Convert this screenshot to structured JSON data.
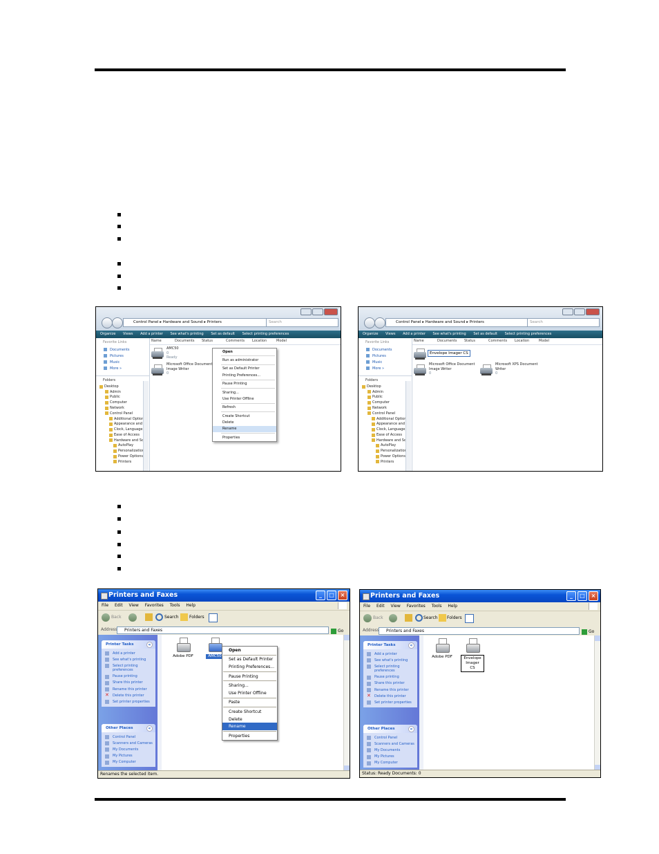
{
  "vista_left": {
    "address": [
      "Control Panel",
      "Hardware and Sound",
      "Printers"
    ],
    "search_placeholder": "Search",
    "toolbar": [
      "Organize",
      "Views",
      "Add a printer",
      "See what's printing",
      "Set as default",
      "Select printing preferences"
    ],
    "favorite_links_title": "Favorite Links",
    "favorite_links": [
      "Documents",
      "Pictures",
      "Music",
      "More »"
    ],
    "folders_label": "Folders",
    "tree": [
      "Desktop",
      "Admin",
      "Public",
      "Computer",
      "Network",
      "Control Panel",
      "Additional Options",
      "Appearance and P",
      "Clock, Language, a",
      "Ease of Access",
      "Hardware and Sou",
      "AutoPlay",
      "Personalization",
      "Power Options",
      "Printers"
    ],
    "columns": [
      "Name",
      "Documents",
      "Status",
      "Comments",
      "Location",
      "Model"
    ],
    "item1_name": "AMC50",
    "item1_docs": "0",
    "item1_status": "Ready",
    "item2_name_1": "Microsoft Office Document",
    "item2_name_2": "Image Writer",
    "item2_docs": "0",
    "context_menu": [
      "Open",
      "Run as administrator",
      "Set as Default Printer",
      "Printing Preferences...",
      "Pause Printing",
      "Sharing...",
      "Use Printer Offline",
      "Refresh",
      "Create Shortcut",
      "Delete",
      "Rename",
      "Properties"
    ]
  },
  "vista_right": {
    "address": [
      "Control Panel",
      "Hardware and Sound",
      "Printers"
    ],
    "search_placeholder": "Search",
    "toolbar": [
      "Organize",
      "Views",
      "Add a printer",
      "See what's printing",
      "Set as default",
      "Select printing preferences"
    ],
    "favorite_links_title": "Favorite Links",
    "favorite_links": [
      "Documents",
      "Pictures",
      "Music",
      "More »"
    ],
    "folders_label": "Folders",
    "tree": [
      "Desktop",
      "Admin",
      "Public",
      "Computer",
      "Network",
      "Control Panel",
      "Additional Options",
      "Appearance and P",
      "Clock, Language, a",
      "Ease of Access",
      "Hardware and Sou",
      "AutoPlay",
      "Personalization",
      "Power Options",
      "Printers"
    ],
    "columns": [
      "Name",
      "Documents",
      "Status",
      "Comments",
      "Location",
      "Model"
    ],
    "rename_value": "Envelope Imager CS",
    "item2_name_1": "Microsoft Office Document",
    "item2_name_2": "Image Writer",
    "item2_docs": "0",
    "item3_name_1": "Microsoft XPS Document",
    "item3_name_2": "Writer",
    "item3_docs": "0"
  },
  "xp_left": {
    "title": "Printers and Faxes",
    "menu": [
      "File",
      "Edit",
      "View",
      "Favorites",
      "Tools",
      "Help"
    ],
    "toolbar": {
      "back": "Back",
      "search": "Search",
      "folders": "Folders"
    },
    "address_label": "Address",
    "address_value": "Printers and Faxes",
    "go": "Go",
    "printer_tasks_title": "Printer Tasks",
    "printer_tasks": [
      "Add a printer",
      "See what's printing",
      "Select printing preferences",
      "Pause printing",
      "Share this printer",
      "Rename this printer",
      "Delete this printer",
      "Set printer properties"
    ],
    "other_places_title": "Other Places",
    "other_places": [
      "Control Panel",
      "Scanners and Cameras",
      "My Documents",
      "My Pictures",
      "My Computer"
    ],
    "printers": [
      "Adobe PDF",
      "AMC50"
    ],
    "context_menu": [
      "Open",
      "Set as Default Printer",
      "Printing Preferences...",
      "Pause Printing",
      "Sharing...",
      "Use Printer Offline",
      "Paste",
      "Create Shortcut",
      "Delete",
      "Rename",
      "Properties"
    ],
    "status": "Renames the selected item."
  },
  "xp_right": {
    "title": "Printers and Faxes",
    "menu": [
      "File",
      "Edit",
      "View",
      "Favorites",
      "Tools",
      "Help"
    ],
    "toolbar": {
      "back": "Back",
      "search": "Search",
      "folders": "Folders"
    },
    "address_label": "Address",
    "address_value": "Printers and Faxes",
    "go": "Go",
    "printer_tasks_title": "Printer Tasks",
    "printer_tasks": [
      "Add a printer",
      "See what's printing",
      "Select printing preferences",
      "Pause printing",
      "Share this printer",
      "Rename this printer",
      "Delete this printer",
      "Set printer properties"
    ],
    "other_places_title": "Other Places",
    "other_places": [
      "Control Panel",
      "Scanners and Cameras",
      "My Documents",
      "My Pictures",
      "My Computer"
    ],
    "printers": [
      "Adobe PDF",
      "Envelope Imager CS"
    ],
    "status": "Status: Ready Documents: 0"
  }
}
